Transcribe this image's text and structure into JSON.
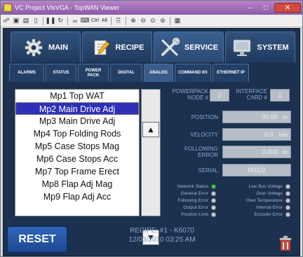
{
  "window": {
    "title": "VC Project VisVGA - TopWAN Viewer"
  },
  "toolbar": {
    "ctrl_label": "Ctrl",
    "alt_label": "Alt"
  },
  "nav": {
    "tabs": [
      {
        "label": "MAIN",
        "icon": "gear-icon"
      },
      {
        "label": "RECIPE",
        "icon": "recipe-icon"
      },
      {
        "label": "SERVICE",
        "icon": "tools-icon"
      },
      {
        "label": "SYSTEM",
        "icon": "monitor-icon"
      }
    ]
  },
  "subtabs": [
    {
      "label": "ALARMS"
    },
    {
      "label": "STATUS"
    },
    {
      "label": "POWER PACK"
    },
    {
      "label": "DIGITAL"
    },
    {
      "label": "ANALOG"
    },
    {
      "label": "COMMAND I/O"
    },
    {
      "label": "ETHERNET IP"
    }
  ],
  "motor_list": {
    "items": [
      "Mp1 Top WAT",
      "Mp2 Main Drive Adj",
      "Mp3 Main Drive Adj",
      "Mp4 Top Folding Rods",
      "Mp5 Case Stops Mag",
      "Mp6 Case Stops Acc",
      "Mp7 Top Frame Erect",
      "Mp8  Flap Adj Mag",
      "Mp9 Flap Adj Acc"
    ],
    "selected_index": 1
  },
  "fields": {
    "powerpack_label": "POWERPACK NODE #",
    "powerpack_value": "2",
    "interface_label": "INTERFACE CARD #",
    "interface_value": "1",
    "position_label": "POSITION",
    "position_value": "00.00",
    "position_unit": "in",
    "velocity_label": "VELOCITY",
    "velocity_value": "0.0",
    "velocity_unit": "in/s",
    "following_label": "FOLLOWING ERROR",
    "following_value": "0.000",
    "following_unit": "in",
    "serial_label": "SERIAL",
    "serial_value": "M31/2"
  },
  "status_left": [
    {
      "label": "Network Status",
      "on": true
    },
    {
      "label": "General Error",
      "on": false
    },
    {
      "label": "Following Error",
      "on": false
    },
    {
      "label": "Output Error",
      "on": false
    },
    {
      "label": "Position Limit",
      "on": false
    }
  ],
  "status_right": [
    {
      "label": "Low Bus Voltage",
      "on": false
    },
    {
      "label": "Over Voltage",
      "on": false
    },
    {
      "label": "Over Temperature",
      "on": false
    },
    {
      "label": "Internal Error",
      "on": false
    },
    {
      "label": "Encoder Error",
      "on": false
    }
  ],
  "bottom": {
    "reset_label": "RESET",
    "recipe_line": "RECIPE: #1 - K6070",
    "datetime_line": "12/03/2010   03:25 AM"
  },
  "colors": {
    "hmi_background": "#1c3150",
    "selected_row": "#2f2fb8",
    "led_on": "#3ed24a"
  }
}
